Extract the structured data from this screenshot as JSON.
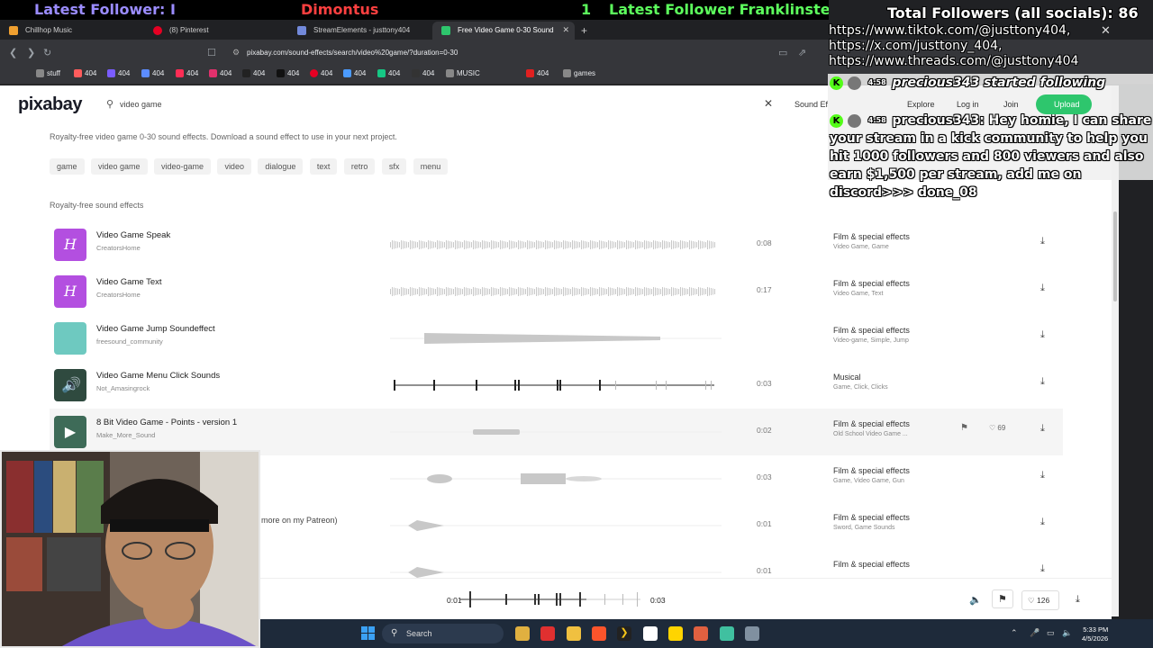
{
  "overlay": {
    "ticker_latest_follower_1": "Latest Follower: I",
    "ticker_name": "Dimontus",
    "ticker_count": "1",
    "ticker_latest_follower_2": "Latest Follower Franklinste",
    "total_followers": "Total Followers (all socials): 86",
    "links": [
      "https://www.tiktok.com/@justtony404,",
      "https://x.com/justtony_404,",
      "https://www.threads.com/@justtony404"
    ],
    "chat": [
      {
        "time": "4:58",
        "user": "precious343:",
        "message": "precious343 started following"
      },
      {
        "time": "4:58",
        "user": "precious343:",
        "message": "Hey homie, I can share your stream in a kick community to help you hit 1000 followers and 800 viewers and also earn $1,500 per stream, add me on discord>>> done_08"
      }
    ]
  },
  "browser": {
    "tabs": [
      {
        "label": "Chillhop Music",
        "color": "#f0a030"
      },
      {
        "label": "(8) Pinterest",
        "color": "#e60023"
      },
      {
        "label": "StreamElements - justtony404",
        "color": "#7289da"
      },
      {
        "label": "Free Video Game 0-30 Sound",
        "color": "#2ec66d"
      }
    ],
    "url": "pixabay.com/sound-effects/search/video%20game/?duration=0-30",
    "bookmarks": [
      {
        "label": "stuff",
        "color": "#888"
      },
      {
        "label": "404",
        "color": "#ff5c5c"
      },
      {
        "label": "404",
        "color": "#7a5cff"
      },
      {
        "label": "404",
        "color": "#5c8cff"
      },
      {
        "label": "404",
        "color": "#ff2d55"
      },
      {
        "label": "404",
        "color": "#e1306c"
      },
      {
        "label": "404",
        "color": "#222"
      },
      {
        "label": "404",
        "color": "#111"
      },
      {
        "label": "404",
        "color": "#e60023"
      },
      {
        "label": "404",
        "color": "#4b9bff"
      },
      {
        "label": "404",
        "color": "#16c784"
      },
      {
        "label": "404",
        "color": "#333"
      },
      {
        "label": "MUSIC",
        "color": "#888"
      },
      {
        "label": "404",
        "color": "#e02020"
      },
      {
        "label": "games",
        "color": "#888"
      }
    ]
  },
  "pixabay": {
    "logo": "pixabay",
    "search_value": "video game",
    "sound_effects_label": "Sound Ef",
    "explore": "Explore",
    "login": "Log in",
    "join": "Join",
    "upload": "Upload",
    "subtitle": "Royalty-free video game 0-30 sound effects. Download a sound effect to use in your next project.",
    "tags": [
      "game",
      "video game",
      "video-game",
      "video",
      "dialogue",
      "text",
      "retro",
      "sfx",
      "menu"
    ],
    "section_title": "Royalty-free sound effects",
    "results": [
      {
        "title": "Video Game Speak",
        "author": "CreatorsHome",
        "duration": "0:08",
        "category": "Film & special effects",
        "tags": "Video Game, Game",
        "thumb": "#b34fe0",
        "thumb_text": "H"
      },
      {
        "title": "Video Game Text",
        "author": "CreatorsHome",
        "duration": "0:17",
        "category": "Film & special effects",
        "tags": "Video Game, Text",
        "thumb": "#b34fe0",
        "thumb_text": "H"
      },
      {
        "title": "Video Game Jump Soundeffect",
        "author": "freesound_community",
        "duration": "",
        "category": "Film & special effects",
        "tags": "Video-game, Simple, Jump",
        "thumb": "#6ec9c0",
        "thumb_text": ""
      },
      {
        "title": "Video Game Menu Click Sounds",
        "author": "Not_Amasingrock",
        "duration": "0:03",
        "category": "Musical",
        "tags": "Game, Click, Clicks",
        "thumb": "#2f4a3f",
        "thumb_text": "🔊"
      },
      {
        "title": "8 Bit Video Game - Points - version 1",
        "author": "Make_More_Sound",
        "duration": "0:02",
        "category": "Film & special effects",
        "tags": "Old School Video Game ...",
        "thumb": "#3e6b58",
        "thumb_text": "▶",
        "likes": "69"
      },
      {
        "title": "",
        "author": "",
        "duration": "0:03",
        "category": "Film & special effects",
        "tags": "Game, Video Game, Gun",
        "thumb": "",
        "thumb_text": ""
      },
      {
        "title": "",
        "author": "",
        "duration": "0:01",
        "category": "Film & special effects",
        "tags": "Sword, Game Sounds",
        "thumb": "",
        "thumb_text": ""
      },
      {
        "title": "",
        "author": "",
        "duration": "0:01",
        "category": "Film & special effects",
        "tags": "",
        "thumb": "",
        "thumb_text": ""
      }
    ],
    "patreon_text": "more on my Patreon)"
  },
  "player": {
    "current_time": "0:01",
    "total_time": "0:03",
    "likes": "126"
  },
  "taskbar": {
    "search_label": "Search",
    "time": "5:33 PM",
    "date": "4/5/2026"
  }
}
